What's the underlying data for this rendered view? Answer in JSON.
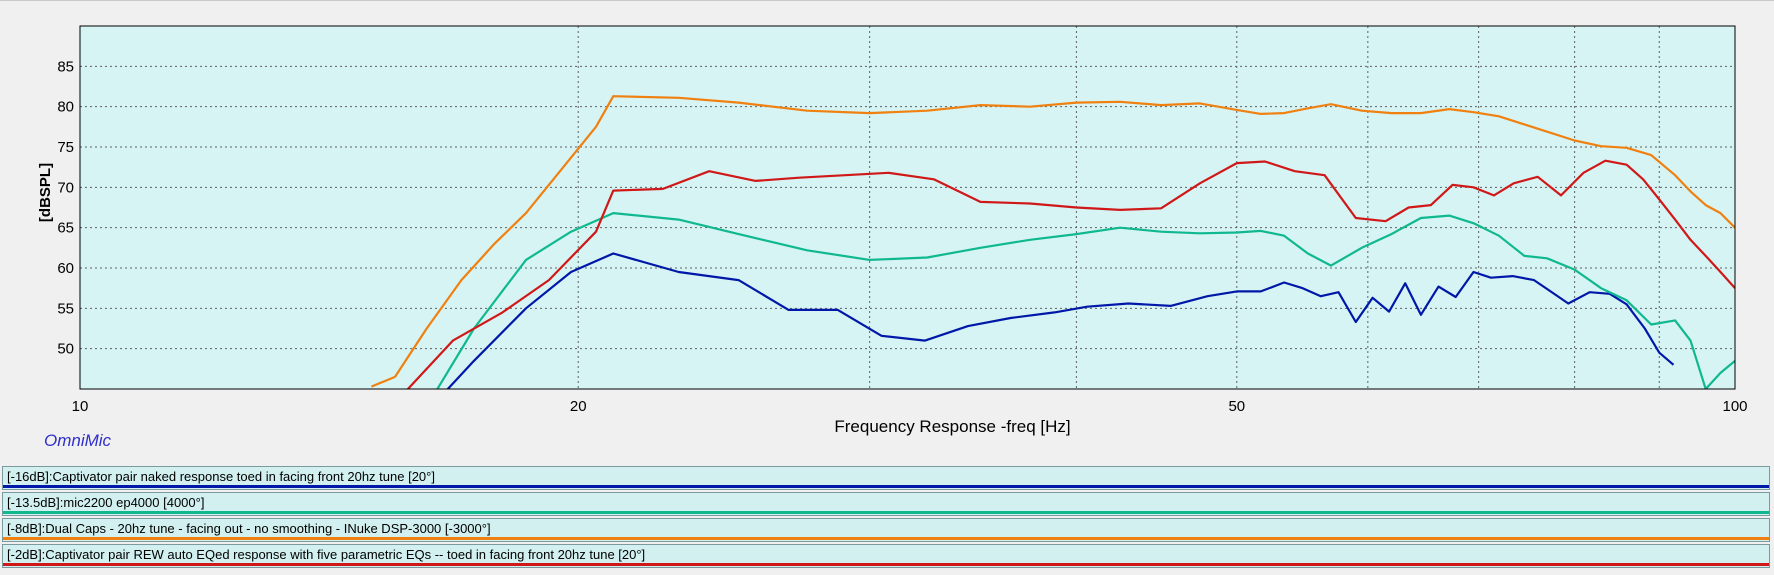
{
  "chart_data": {
    "type": "line",
    "xscale": "log",
    "xlim": [
      10,
      100
    ],
    "ylim": [
      45,
      90
    ],
    "xticks": [
      10,
      20,
      50,
      100
    ],
    "yticks": [
      50,
      55,
      60,
      65,
      70,
      75,
      80,
      85
    ],
    "xlabel": "Frequency Response -freq [Hz]",
    "ylabel": "[dBSPL]",
    "grid": true,
    "plot_background": "#d6f4f4",
    "series": [
      {
        "name": "[-16dB]:Captivator pair naked response toed in facing front 20hz tune [20°]",
        "color": "#0018a8",
        "x": [
          16.0,
          17.3,
          18.6,
          19.8,
          21.0,
          23.0,
          25.0,
          26.8,
          28.7,
          30.5,
          32.4,
          34.4,
          36.5,
          38.8,
          40.6,
          43.0,
          45.6,
          48.0,
          50.0,
          51.7,
          53.4,
          54.8,
          56.2,
          57.6,
          59.0,
          60.4,
          61.8,
          63.2,
          64.6,
          66.2,
          67.8,
          69.5,
          71.2,
          73.4,
          75.6,
          77.0,
          79.3,
          81.7,
          84.0,
          86.0,
          88.2,
          90.0,
          91.8
        ],
        "y": [
          41.0,
          48.5,
          55.0,
          59.5,
          61.8,
          59.5,
          58.5,
          54.8,
          54.8,
          51.6,
          51.0,
          52.8,
          53.8,
          54.5,
          55.2,
          55.6,
          55.3,
          56.5,
          57.1,
          57.1,
          58.2,
          57.5,
          56.5,
          57.0,
          53.3,
          56.3,
          54.6,
          58.1,
          54.2,
          57.7,
          56.4,
          59.5,
          58.8,
          59.0,
          58.5,
          57.4,
          55.6,
          57.0,
          56.8,
          55.5,
          52.5,
          49.5,
          48.0
        ]
      },
      {
        "name": "[-13.5dB]:mic2200 ep4000 [4000°]",
        "color": "#10b890",
        "x": [
          16.0,
          17.3,
          18.6,
          19.8,
          21.0,
          23.0,
          25.0,
          27.5,
          30.0,
          32.5,
          35.0,
          37.5,
          40.0,
          42.5,
          45.0,
          47.5,
          50.0,
          51.7,
          53.4,
          55.2,
          57.0,
          59.5,
          62.0,
          64.6,
          67.2,
          69.6,
          72.0,
          74.6,
          77.0,
          80.0,
          83.0,
          86.0,
          89.0,
          92.0,
          94.0,
          96.0,
          98.0,
          100.0
        ],
        "y": [
          41.0,
          52.5,
          61.0,
          64.5,
          66.8,
          66.0,
          64.2,
          62.2,
          61.0,
          61.3,
          62.5,
          63.5,
          64.2,
          65.0,
          64.5,
          64.3,
          64.4,
          64.6,
          64.0,
          61.8,
          60.3,
          62.5,
          64.2,
          66.2,
          66.5,
          65.5,
          64.0,
          61.5,
          61.2,
          59.8,
          57.5,
          56.0,
          53.0,
          53.5,
          51.0,
          45.0,
          47.0,
          48.5
        ]
      },
      {
        "name": "[-8dB]:Dual Caps - 20hz tune - facing out - no smoothing - INuke DSP-3000 [-3000°]",
        "color": "#f08010",
        "x": [
          15.0,
          15.5,
          16.2,
          17.0,
          17.8,
          18.6,
          19.5,
          20.5,
          21.0,
          23.0,
          25.0,
          27.5,
          30.0,
          32.5,
          35.0,
          37.5,
          40.0,
          42.5,
          45.0,
          47.5,
          50.0,
          51.7,
          53.4,
          55.2,
          57.0,
          59.5,
          62.0,
          64.6,
          67.2,
          69.6,
          72.0,
          74.6,
          77.0,
          80.0,
          83.0,
          86.0,
          89.0,
          92.0,
          94.0,
          96.0,
          98.0,
          100.0
        ],
        "y": [
          45.3,
          46.5,
          52.5,
          58.5,
          63.0,
          66.8,
          72.0,
          77.5,
          81.3,
          81.1,
          80.5,
          79.5,
          79.2,
          79.5,
          80.2,
          80.0,
          80.5,
          80.6,
          80.2,
          80.4,
          79.6,
          79.1,
          79.2,
          79.8,
          80.3,
          79.5,
          79.2,
          79.2,
          79.7,
          79.3,
          78.8,
          77.8,
          76.9,
          75.8,
          75.1,
          74.9,
          74.0,
          71.5,
          69.5,
          67.8,
          66.8,
          65.0
        ]
      },
      {
        "name": "[-2dB]:Captivator pair REW auto EQed response with five parametric EQs -- toed in facing front 20hz tune [20°]",
        "color": "#d01818",
        "x": [
          15.7,
          16.8,
          18.0,
          19.2,
          20.5,
          21.0,
          22.5,
          24.0,
          25.6,
          27.2,
          29.0,
          30.8,
          32.8,
          35.0,
          37.5,
          40.0,
          42.5,
          45.0,
          47.5,
          50.0,
          52.0,
          54.2,
          56.5,
          59.0,
          61.5,
          63.5,
          65.5,
          67.5,
          69.5,
          71.5,
          73.5,
          76.0,
          78.5,
          81.0,
          83.5,
          86.0,
          88.0,
          90.0,
          92.0,
          94.0,
          96.0,
          98.0,
          100.0
        ],
        "y": [
          44.5,
          51.0,
          54.5,
          58.5,
          64.5,
          69.6,
          69.8,
          72.0,
          70.8,
          71.2,
          71.5,
          71.8,
          71.0,
          68.2,
          68.0,
          67.5,
          67.2,
          67.4,
          70.5,
          73.0,
          73.2,
          72.0,
          71.5,
          66.2,
          65.8,
          67.5,
          67.8,
          70.3,
          70.0,
          69.0,
          70.5,
          71.3,
          69.0,
          71.8,
          73.3,
          72.8,
          71.0,
          68.5,
          66.0,
          63.5,
          61.5,
          59.5,
          57.5
        ]
      }
    ]
  },
  "brand": "OmniMic",
  "legend": [
    {
      "label": "[-16dB]:Captivator pair naked response toed in facing front 20hz tune [20°]",
      "color": "#0018a8"
    },
    {
      "label": "[-13.5dB]:mic2200 ep4000 [4000°]",
      "color": "#10b890"
    },
    {
      "label": "[-8dB]:Dual Caps - 20hz tune - facing out - no smoothing - INuke DSP-3000 [-3000°]",
      "color": "#f08010"
    },
    {
      "label": "[-2dB]:Captivator pair REW auto EQed response with five parametric EQs -- toed in facing front 20hz tune [20°]",
      "color": "#d01818"
    }
  ]
}
